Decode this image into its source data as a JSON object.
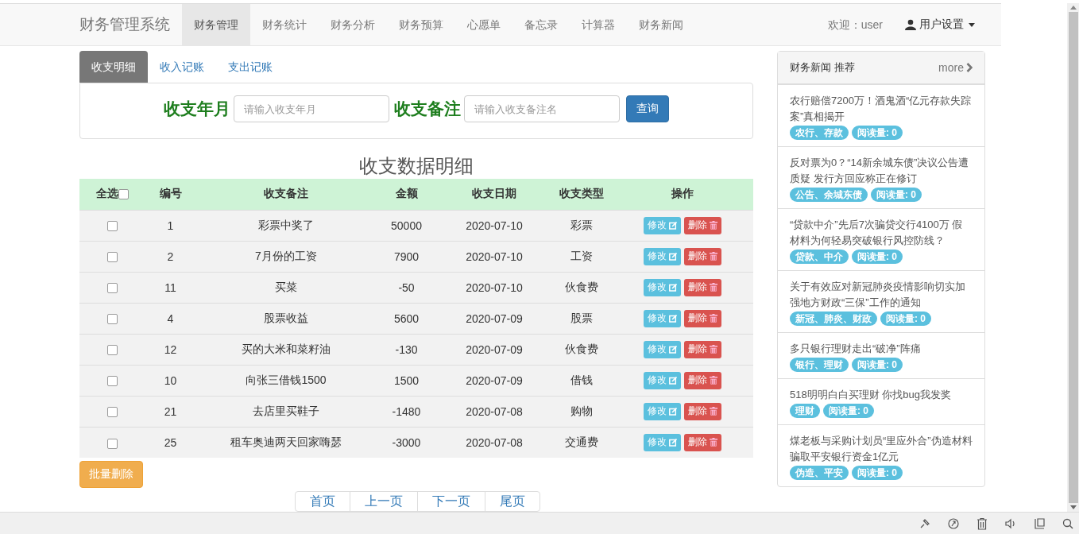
{
  "navbar": {
    "brand": "财务管理系统",
    "items": [
      {
        "label": "财务管理",
        "selected": true
      },
      {
        "label": "财务统计",
        "selected": false
      },
      {
        "label": "财务分析",
        "selected": false
      },
      {
        "label": "财务预算",
        "selected": false
      },
      {
        "label": "心愿单",
        "selected": false
      },
      {
        "label": "备忘录",
        "selected": false
      },
      {
        "label": "计算器",
        "selected": false
      },
      {
        "label": "财务新闻",
        "selected": false
      }
    ],
    "welcome": "欢迎：user",
    "user_menu": "用户设置"
  },
  "tabs": [
    {
      "label": "收支明细",
      "selected": true
    },
    {
      "label": "收入记账",
      "selected": false
    },
    {
      "label": "支出记账",
      "selected": false
    }
  ],
  "search": {
    "month_label": "收支年月",
    "month_placeholder": "请输入收支年月",
    "note_label": "收支备注",
    "note_placeholder": "请输入收支备注名",
    "button": "查询"
  },
  "table": {
    "title": "收支数据明细",
    "select_all": {
      "label": "全选",
      "checked": false
    },
    "columns": [
      "编号",
      "收支备注",
      "金额",
      "收支日期",
      "收支类型",
      "操作"
    ],
    "rows": [
      {
        "checked": false,
        "cells": [
          "1",
          "彩票中奖了",
          "50000",
          "2020-07-10",
          "彩票"
        ],
        "edit": "修改",
        "delete": "删除"
      },
      {
        "checked": false,
        "cells": [
          "2",
          "7月份的工资",
          "7900",
          "2020-07-10",
          "工资"
        ],
        "edit": "修改",
        "delete": "删除"
      },
      {
        "checked": false,
        "cells": [
          "11",
          "买菜",
          "-50",
          "2020-07-10",
          "伙食费"
        ],
        "edit": "修改",
        "delete": "删除"
      },
      {
        "checked": false,
        "cells": [
          "4",
          "股票收益",
          "5600",
          "2020-07-09",
          "股票"
        ],
        "edit": "修改",
        "delete": "删除"
      },
      {
        "checked": false,
        "cells": [
          "12",
          "买的大米和菜籽油",
          "-130",
          "2020-07-09",
          "伙食费"
        ],
        "edit": "修改",
        "delete": "删除"
      },
      {
        "checked": false,
        "cells": [
          "10",
          "向张三借钱1500",
          "1500",
          "2020-07-09",
          "借钱"
        ],
        "edit": "修改",
        "delete": "删除"
      },
      {
        "checked": false,
        "cells": [
          "21",
          "去店里买鞋子",
          "-1480",
          "2020-07-08",
          "购物"
        ],
        "edit": "修改",
        "delete": "删除"
      },
      {
        "checked": false,
        "cells": [
          "25",
          "租车奥迪两天回家嗨瑟",
          "-3000",
          "2020-07-08",
          "交通费"
        ],
        "edit": "修改",
        "delete": "删除"
      }
    ]
  },
  "batch_delete": "批量删除",
  "pagination": [
    "首页",
    "上一页",
    "下一页",
    "尾页"
  ],
  "news": {
    "title": "财务新闻 推荐",
    "more": "more",
    "items": [
      {
        "title": "农行赔偿7200万！酒鬼酒“亿元存款失踪案”真相揭开",
        "tags": "农行、存款",
        "reads": "阅读量: 0"
      },
      {
        "title": "反对票为0？“14新余城东债”决议公告遭质疑 发行方回应称正在修订",
        "tags": "公告、余城东债",
        "reads": "阅读量: 0"
      },
      {
        "title": "“贷款中介”先后7次骗贷交行4100万 假材料为何轻易突破银行风控防线？",
        "tags": "贷款、中介",
        "reads": "阅读量: 0"
      },
      {
        "title": "关于有效应对新冠肺炎疫情影响切实加强地方财政“三保”工作的通知",
        "tags": "新冠、肺炎、财政",
        "reads": "阅读量: 0"
      },
      {
        "title": "多只银行理财走出“破净”阵痛",
        "tags": "银行、理财",
        "reads": "阅读量: 0"
      },
      {
        "title": "518明明白白买理财 你找bug我发奖",
        "tags": "理财",
        "reads": "阅读量: 0"
      },
      {
        "title": "煤老板与采购计划员“里应外合”伪造材料骗取平安银行资金1亿元",
        "tags": "伪造、平安",
        "reads": "阅读量: 0"
      }
    ]
  }
}
